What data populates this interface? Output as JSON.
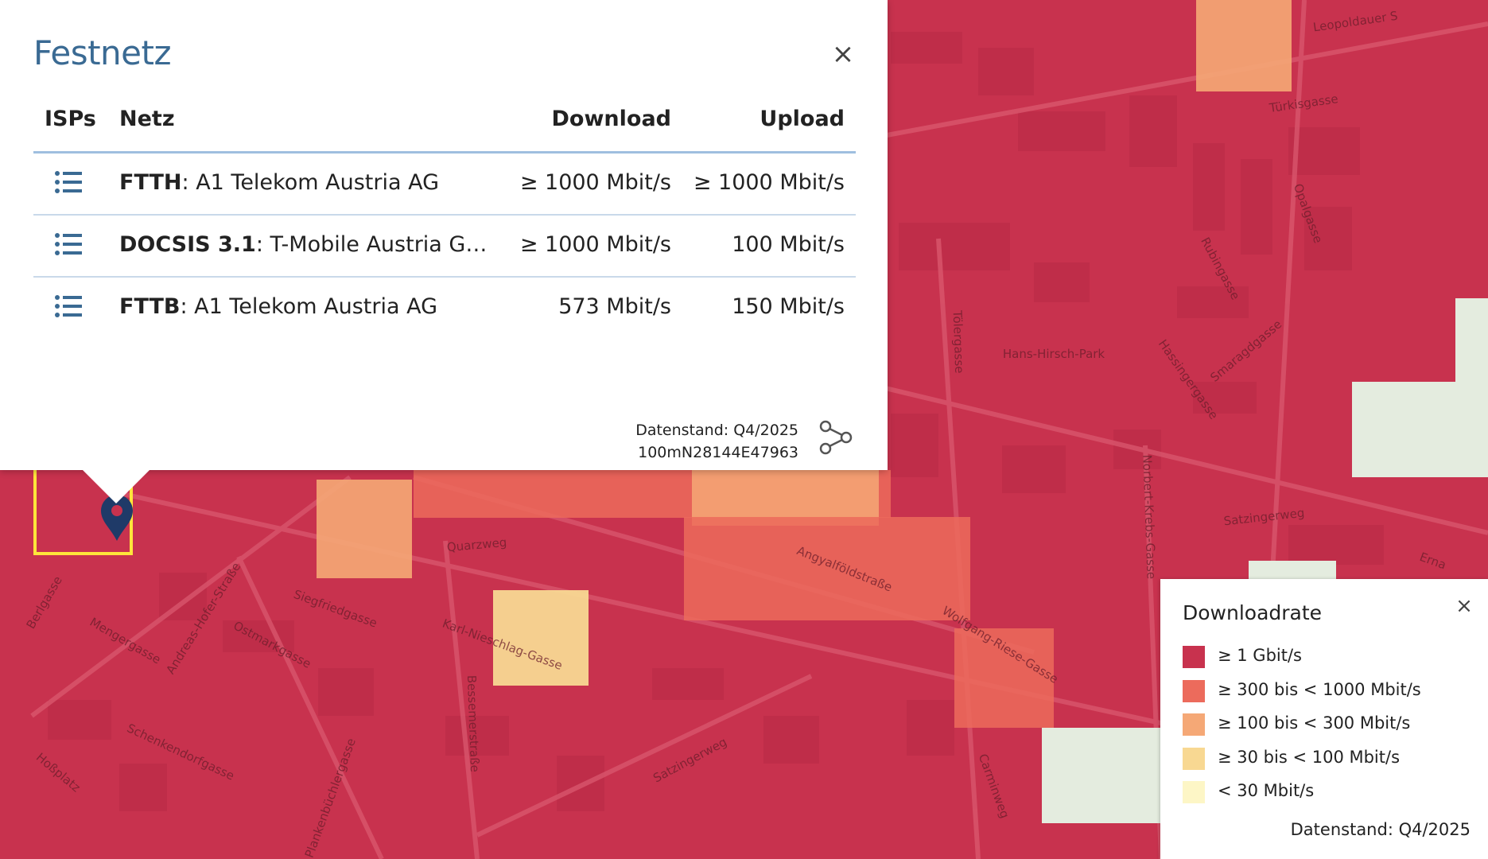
{
  "popup": {
    "title": "Festnetz",
    "close_label": "×",
    "columns": {
      "isps": "ISPs",
      "netz": "Netz",
      "download": "Download",
      "upload": "Upload"
    },
    "rows": [
      {
        "tech": "FTTH",
        "sep": ": ",
        "provider": "A1 Telekom Austria AG",
        "download": "≥ 1000 Mbit/s",
        "upload": "≥ 1000 Mbit/s"
      },
      {
        "tech": "DOCSIS 3.1",
        "sep": ": ",
        "provider": "T-Mobile Austria Gm…",
        "download": "≥ 1000 Mbit/s",
        "upload": "100 Mbit/s"
      },
      {
        "tech": "FTTB",
        "sep": ": ",
        "provider": "A1 Telekom Austria AG",
        "download": "573 Mbit/s",
        "upload": "150 Mbit/s"
      }
    ],
    "footer_date": "Datenstand: Q4/2025",
    "footer_cell": "100mN28144E47963"
  },
  "legend": {
    "title": "Downloadrate",
    "close_label": "×",
    "items": [
      {
        "label": "≥ 1 Gbit/s",
        "color": "#c8324e"
      },
      {
        "label": "≥ 300 bis < 1000 Mbit/s",
        "color": "#ec6b5c"
      },
      {
        "label": "≥ 100 bis < 300 Mbit/s",
        "color": "#f5a876"
      },
      {
        "label": "≥ 30 bis < 100 Mbit/s",
        "color": "#f8d892"
      },
      {
        "label": "< 30 Mbit/s",
        "color": "#fdf6c6"
      }
    ],
    "footer": "Datenstand: Q4/2025"
  },
  "map": {
    "streets": [
      "Leopoldauer S",
      "Türkisgasse",
      "Opalgasse",
      "Rubingasse",
      "Tölergasse",
      "Hans-Hirsch-Park",
      "Smaragdgasse",
      "Hassingergasse",
      "Norbert-Krebs-Gasse",
      "Satzingerweg",
      "Angyalföldstraße",
      "Wolfgang-Riese-Gasse",
      "Quarzweg",
      "Siegfriedgasse",
      "Karl-Nieschlag-Gasse",
      "Andreas-Hofer-Straße",
      "Ostmarkgasse",
      "Mengergasse",
      "Bessemerstraße",
      "Satzingerweg",
      "Schenkendorfgasse",
      "Plankenbüchlergasse",
      "Hoßplatz",
      "Carminweg",
      "Berlgasse",
      "Erna"
    ],
    "colors": {
      "gbit": "#c8324e",
      "r300": "#ec6b5c",
      "r100": "#f5a876",
      "r30": "#f8d892",
      "low": "#fdf6c6",
      "green": "#e4ecdf",
      "selection": "#ffe53b",
      "marker": "#1f3a68"
    }
  }
}
